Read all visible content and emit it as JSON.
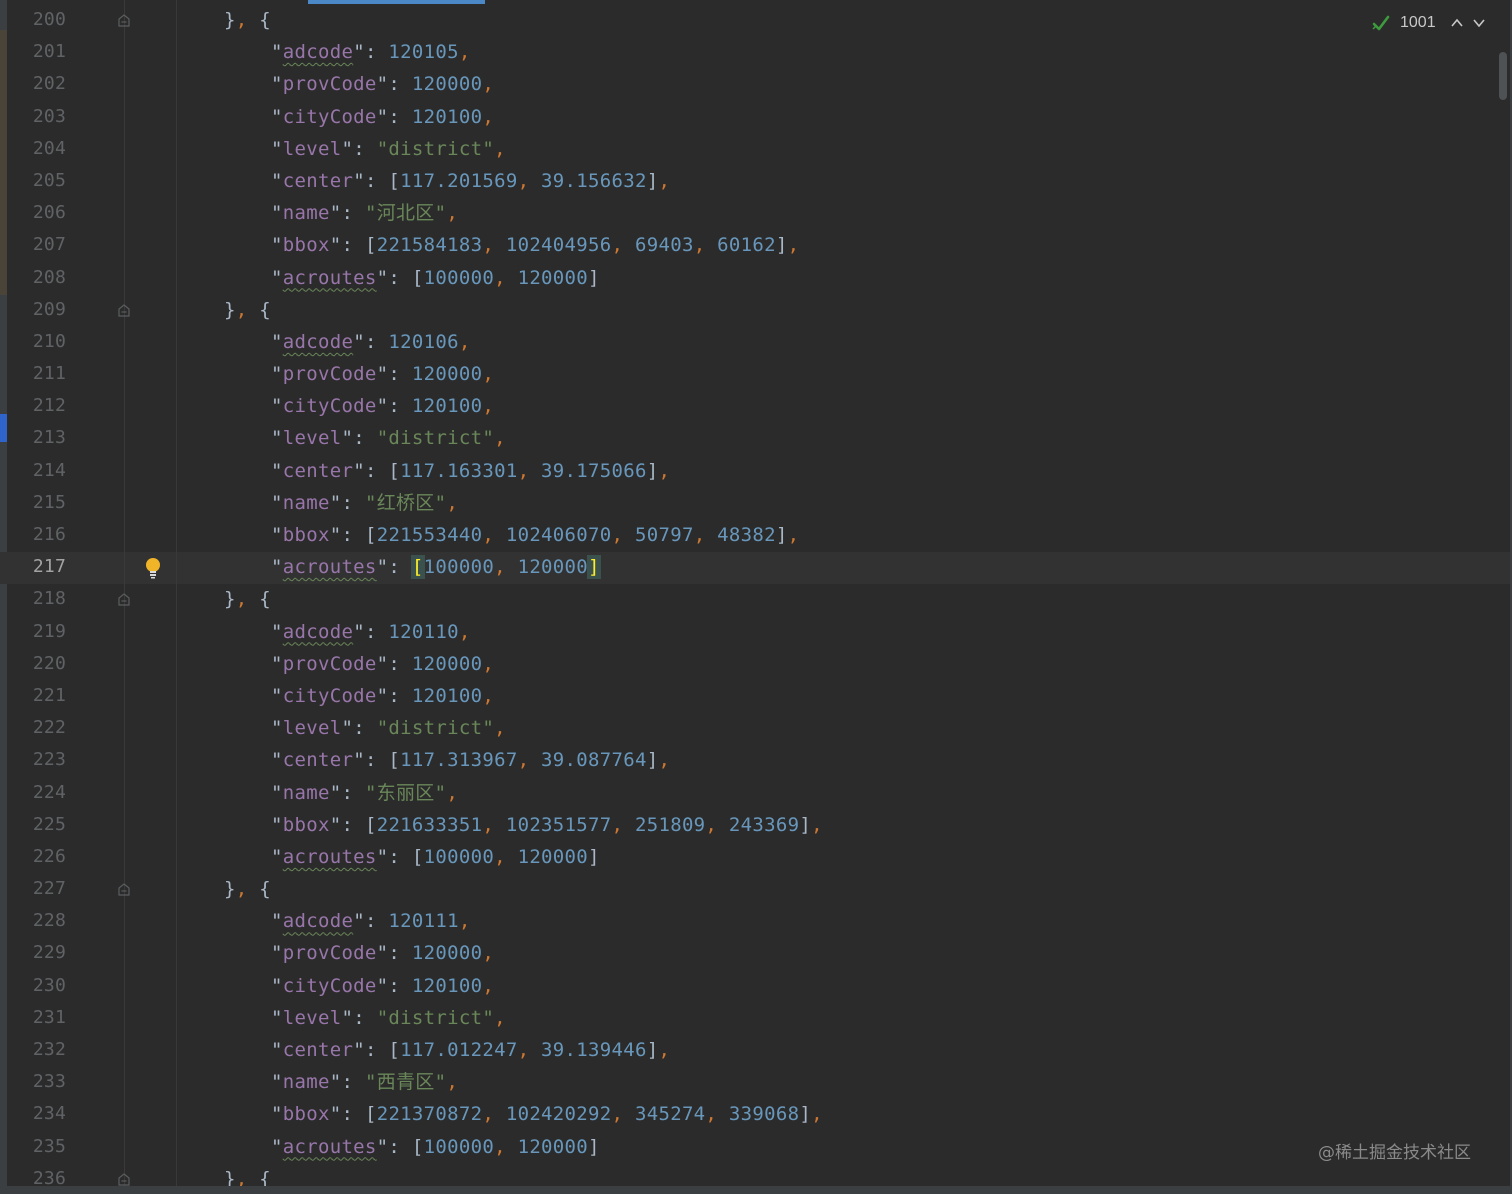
{
  "editor": {
    "status": {
      "inspection_count": "1001",
      "check_color": "#3d9a3d"
    },
    "watermark": "@稀土掘金技术社区",
    "lines": [
      {
        "n": "200",
        "kind": "sep"
      },
      {
        "n": "201",
        "kind": "num",
        "key": "adcode",
        "value": "120105",
        "spell": true
      },
      {
        "n": "202",
        "kind": "num",
        "key": "provCode",
        "value": "120000"
      },
      {
        "n": "203",
        "kind": "num",
        "key": "cityCode",
        "value": "120100"
      },
      {
        "n": "204",
        "kind": "str",
        "key": "level",
        "value": "\"district\""
      },
      {
        "n": "205",
        "kind": "arr",
        "key": "center",
        "values": [
          "117.201569",
          "39.156632"
        ]
      },
      {
        "n": "206",
        "kind": "str",
        "key": "name",
        "value": "\"河北区\""
      },
      {
        "n": "207",
        "kind": "arr",
        "key": "bbox",
        "values": [
          "221584183",
          "102404956",
          "69403",
          "60162"
        ]
      },
      {
        "n": "208",
        "kind": "arr",
        "key": "acroutes",
        "values": [
          "100000",
          "120000"
        ],
        "last": true,
        "spell": true
      },
      {
        "n": "209",
        "kind": "sep"
      },
      {
        "n": "210",
        "kind": "num",
        "key": "adcode",
        "value": "120106",
        "spell": true
      },
      {
        "n": "211",
        "kind": "num",
        "key": "provCode",
        "value": "120000"
      },
      {
        "n": "212",
        "kind": "num",
        "key": "cityCode",
        "value": "120100"
      },
      {
        "n": "213",
        "kind": "str",
        "key": "level",
        "value": "\"district\""
      },
      {
        "n": "214",
        "kind": "arr",
        "key": "center",
        "values": [
          "117.163301",
          "39.175066"
        ]
      },
      {
        "n": "215",
        "kind": "str",
        "key": "name",
        "value": "\"红桥区\""
      },
      {
        "n": "216",
        "kind": "arr",
        "key": "bbox",
        "values": [
          "221553440",
          "102406070",
          "50797",
          "48382"
        ]
      },
      {
        "n": "217",
        "kind": "arr",
        "key": "acroutes",
        "values": [
          "100000",
          "120000"
        ],
        "last": true,
        "spell": true,
        "current": true
      },
      {
        "n": "218",
        "kind": "sep"
      },
      {
        "n": "219",
        "kind": "num",
        "key": "adcode",
        "value": "120110",
        "spell": true
      },
      {
        "n": "220",
        "kind": "num",
        "key": "provCode",
        "value": "120000"
      },
      {
        "n": "221",
        "kind": "num",
        "key": "cityCode",
        "value": "120100"
      },
      {
        "n": "222",
        "kind": "str",
        "key": "level",
        "value": "\"district\""
      },
      {
        "n": "223",
        "kind": "arr",
        "key": "center",
        "values": [
          "117.313967",
          "39.087764"
        ]
      },
      {
        "n": "224",
        "kind": "str",
        "key": "name",
        "value": "\"东丽区\""
      },
      {
        "n": "225",
        "kind": "arr",
        "key": "bbox",
        "values": [
          "221633351",
          "102351577",
          "251809",
          "243369"
        ]
      },
      {
        "n": "226",
        "kind": "arr",
        "key": "acroutes",
        "values": [
          "100000",
          "120000"
        ],
        "last": true,
        "spell": true
      },
      {
        "n": "227",
        "kind": "sep"
      },
      {
        "n": "228",
        "kind": "num",
        "key": "adcode",
        "value": "120111",
        "spell": true
      },
      {
        "n": "229",
        "kind": "num",
        "key": "provCode",
        "value": "120000"
      },
      {
        "n": "230",
        "kind": "num",
        "key": "cityCode",
        "value": "120100"
      },
      {
        "n": "231",
        "kind": "str",
        "key": "level",
        "value": "\"district\""
      },
      {
        "n": "232",
        "kind": "arr",
        "key": "center",
        "values": [
          "117.012247",
          "39.139446"
        ]
      },
      {
        "n": "233",
        "kind": "str",
        "key": "name",
        "value": "\"西青区\""
      },
      {
        "n": "234",
        "kind": "arr",
        "key": "bbox",
        "values": [
          "221370872",
          "102420292",
          "345274",
          "339068"
        ]
      },
      {
        "n": "235",
        "kind": "arr",
        "key": "acroutes",
        "values": [
          "100000",
          "120000"
        ],
        "last": true,
        "spell": true
      },
      {
        "n": "236",
        "kind": "sep"
      }
    ]
  }
}
